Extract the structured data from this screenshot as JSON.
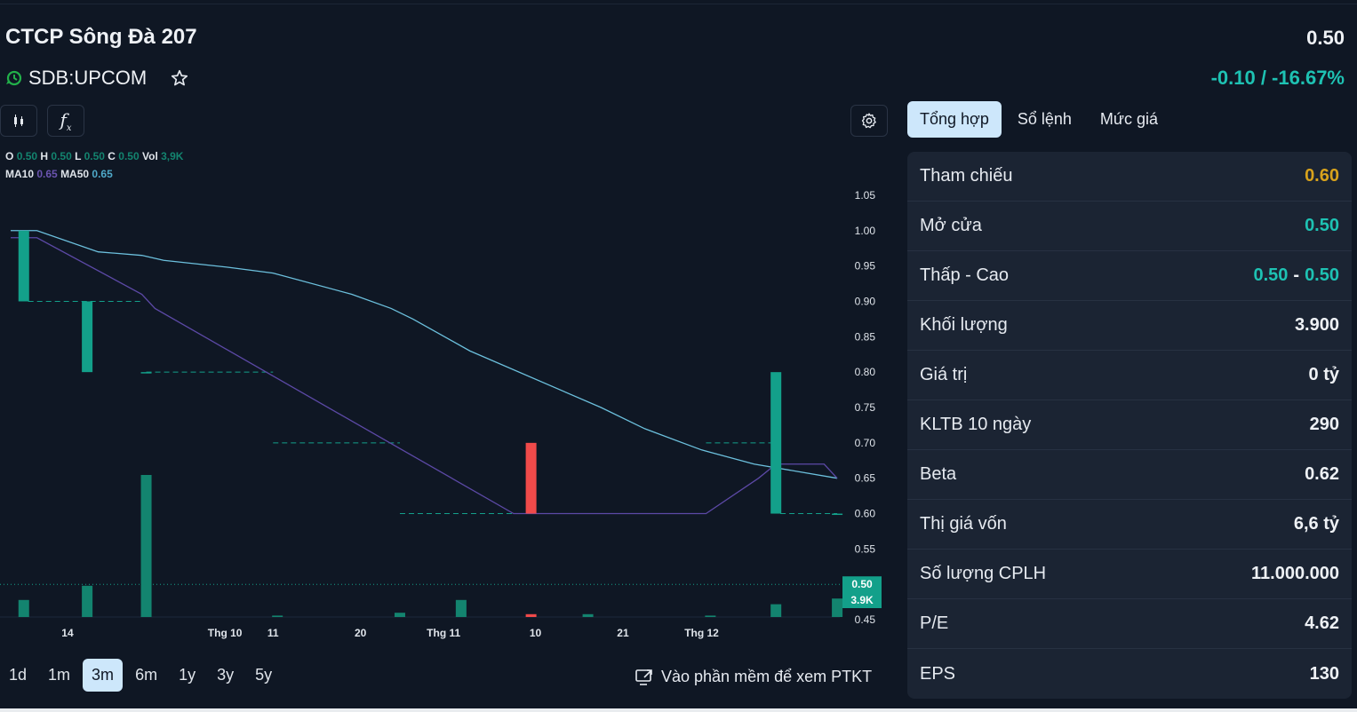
{
  "header": {
    "company_name": "CTCP Sông Đà 207",
    "price": "0.50",
    "ticker": "SDB:UPCOM",
    "change": "-0.10 / -16.67%"
  },
  "legend": {
    "o_label": "O",
    "o_value": "0.50",
    "h_label": "H",
    "h_value": "0.50",
    "l_label": "L",
    "l_value": "0.50",
    "c_label": "C",
    "c_value": "0.50",
    "vol_label": "Vol",
    "vol_value": "3,9K",
    "ma10_label": "MA10",
    "ma10_value": "0.65",
    "ma50_label": "MA50",
    "ma50_value": "0.65"
  },
  "chart_data": {
    "type": "candlestick",
    "y_ticks": [
      "1.05",
      "1.00",
      "0.95",
      "0.90",
      "0.85",
      "0.80",
      "0.75",
      "0.70",
      "0.65",
      "0.60",
      "0.55",
      "0.50",
      "0.45"
    ],
    "ylim": [
      0.43,
      1.07
    ],
    "x_ticks": [
      "14",
      "Thg 10",
      "11",
      "20",
      "Thg 11",
      "10",
      "21",
      "Thg 12"
    ],
    "x_tick_positions": [
      1.3,
      4.9,
      6.0,
      8.0,
      9.9,
      12.0,
      14.0,
      15.8
    ],
    "x_domain": [
      0,
      19
    ],
    "last_price_label": "0.50",
    "last_price": 0.5,
    "volume_label": "3.9K",
    "candles": [
      {
        "x": 0.3,
        "open": 1.0,
        "close": 0.9,
        "color": "#13a08a",
        "ref": 0.9,
        "ref_from": 0.4,
        "ref_to": 3.0
      },
      {
        "x": 1.75,
        "open": 0.9,
        "close": 0.8,
        "color": "#13a08a",
        "ref": 0.8,
        "ref_from": 3.1,
        "ref_to": 6.0
      },
      {
        "x": 3.1,
        "open": 0.8,
        "close": 0.8,
        "color": "#13a08a",
        "ref": 0.7,
        "ref_from": 6.0,
        "ref_to": 8.9
      },
      {
        "x": 11.9,
        "open": 0.6,
        "close": 0.7,
        "color": "#f04a4a",
        "ref": 0.6,
        "ref_from": 8.9,
        "ref_to": 15.9
      },
      {
        "x": 17.5,
        "open": 0.8,
        "close": 0.6,
        "color": "#13a08a",
        "ref": 0.7,
        "ref_from": 15.9,
        "ref_to": 17.4
      },
      {
        "x": 18.9,
        "open": 0.6,
        "close": 0.6,
        "color": "#13a08a",
        "ref": 0.6,
        "ref_from": 17.6,
        "ref_to": 18.9
      }
    ],
    "volumes": [
      {
        "x": 0.3,
        "v": 0.12,
        "color": "#13846f"
      },
      {
        "x": 1.75,
        "v": 0.22,
        "color": "#13846f"
      },
      {
        "x": 3.1,
        "v": 1.0,
        "color": "#13846f"
      },
      {
        "x": 6.1,
        "v": 0.01,
        "color": "#13846f"
      },
      {
        "x": 8.9,
        "v": 0.03,
        "color": "#13846f"
      },
      {
        "x": 10.3,
        "v": 0.12,
        "color": "#13846f"
      },
      {
        "x": 11.9,
        "v": 0.02,
        "color": "#f04a4a"
      },
      {
        "x": 13.2,
        "v": 0.02,
        "color": "#13846f"
      },
      {
        "x": 16.0,
        "v": 0.01,
        "color": "#13846f"
      },
      {
        "x": 17.5,
        "v": 0.09,
        "color": "#13846f"
      },
      {
        "x": 18.9,
        "v": 0.13,
        "color": "#13846f"
      }
    ],
    "ma10": [
      [
        0.0,
        0.99
      ],
      [
        0.6,
        0.99
      ],
      [
        3.0,
        0.91
      ],
      [
        3.3,
        0.89
      ],
      [
        11.5,
        0.6
      ],
      [
        15.9,
        0.6
      ],
      [
        17.1,
        0.65
      ],
      [
        17.5,
        0.67
      ],
      [
        18.6,
        0.67
      ],
      [
        18.9,
        0.65
      ]
    ],
    "ma50": [
      [
        0.0,
        1.0
      ],
      [
        0.6,
        1.0
      ],
      [
        2.0,
        0.97
      ],
      [
        3.0,
        0.965
      ],
      [
        3.5,
        0.958
      ],
      [
        5.0,
        0.948
      ],
      [
        6.0,
        0.94
      ],
      [
        7.8,
        0.91
      ],
      [
        8.7,
        0.89
      ],
      [
        9.2,
        0.875
      ],
      [
        10.5,
        0.83
      ],
      [
        13.5,
        0.75
      ],
      [
        14.5,
        0.72
      ],
      [
        15.8,
        0.69
      ],
      [
        17.0,
        0.67
      ],
      [
        18.9,
        0.65
      ]
    ],
    "colors": {
      "ma10": "#5c49a6",
      "ma50": "#6cc0dd",
      "up": "#13a08a",
      "down": "#f04a4a"
    }
  },
  "timeframes": [
    "1d",
    "1m",
    "3m",
    "6m",
    "1y",
    "3y",
    "5y"
  ],
  "active_timeframe_index": 2,
  "ptkt_link": "Vào phần mềm để xem PTKT",
  "tabs": [
    "Tổng hợp",
    "Sổ lệnh",
    "Mức giá"
  ],
  "summary": {
    "tham_chieu_label": "Tham chiếu",
    "tham_chieu": "0.60",
    "mo_cua_label": "Mở cửa",
    "mo_cua": "0.50",
    "thap_cao_label": "Thấp - Cao",
    "thap": "0.50",
    "cao": "0.50",
    "khoi_luong_label": "Khối lượng",
    "khoi_luong": "3.900",
    "gia_tri_label": "Giá trị",
    "gia_tri": "0 tỷ",
    "kltb_label": "KLTB 10 ngày",
    "kltb": "290",
    "beta_label": "Beta",
    "beta": "0.62",
    "thi_gia_label": "Thị giá vốn",
    "thi_gia": "6,6 tỷ",
    "cplh_label": "Số lượng CPLH",
    "cplh": "11.000.000",
    "pe_label": "P/E",
    "pe": "4.62",
    "eps_label": "EPS",
    "eps": "130"
  },
  "colors": {
    "accent": "#1ec2b3",
    "reference": "#d8a21c",
    "tab_active_bg": "#cde7fb"
  }
}
